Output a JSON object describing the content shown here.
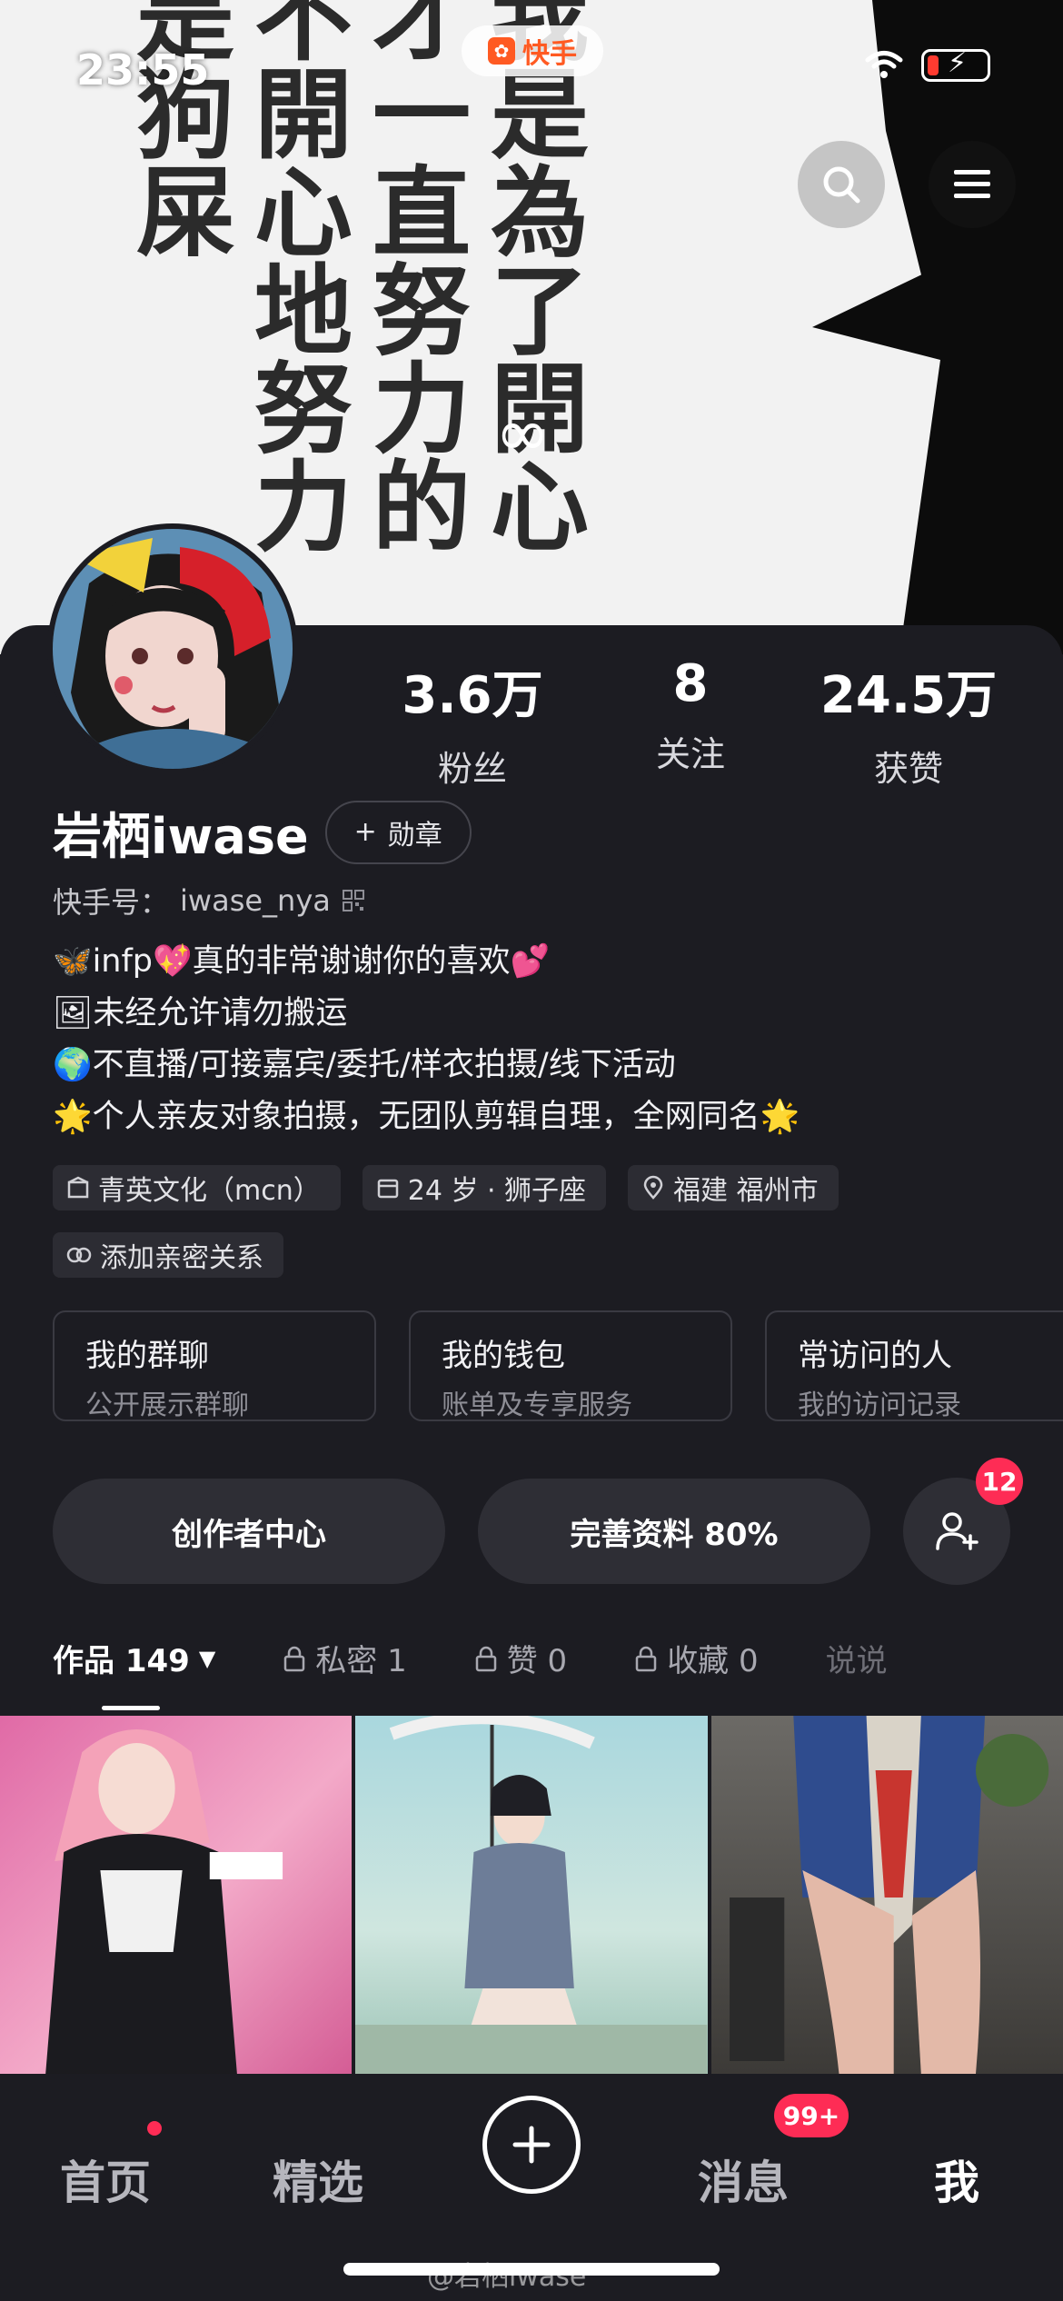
{
  "status_bar": {
    "time": "23:55",
    "app_pill": "快手"
  },
  "banner": {
    "columns": [
      [
        "我",
        "是",
        "為",
        "了",
        "開",
        "心"
      ],
      [
        "才",
        "一",
        "直",
        "努",
        "力",
        "的"
      ],
      [
        "不",
        "開",
        "心",
        "地",
        "努",
        "力"
      ],
      [
        "是",
        "狗",
        "屎"
      ]
    ]
  },
  "profile": {
    "stats": [
      {
        "value": "3.6万",
        "label": "粉丝"
      },
      {
        "value": "8",
        "label": "关注"
      },
      {
        "value": "24.5万",
        "label": "获赞"
      }
    ],
    "name": "岩栖iwase",
    "medal_button": "勋章",
    "kuaishou_id_label": "快手号：",
    "kuaishou_id": "iwase_nya",
    "bio": [
      "🦋infp💖真的非常谢谢你的喜欢💕",
      "🖼未经允许请勿搬运",
      "🌍不直播/可接嘉宾/委托/样衣拍摄/线下活动",
      "🌟个人亲友对象拍摄，无团队剪辑自理，全网同名🌟"
    ],
    "tags": [
      "青英文化（mcn）",
      "24 岁 · 狮子座",
      "福建 福州市"
    ],
    "add_relation": "添加亲密关系"
  },
  "quick_cards": [
    {
      "title": "我的群聊",
      "subtitle": "公开展示群聊"
    },
    {
      "title": "我的钱包",
      "subtitle": "账单及专享服务"
    },
    {
      "title": "常访问的人",
      "subtitle": "我的访问记录"
    }
  ],
  "actions": {
    "creator_center": "创作者中心",
    "complete_profile": "完善资料 80%",
    "friend_badge": "12"
  },
  "tabs": [
    {
      "label": "作品 149"
    },
    {
      "label": "私密 1"
    },
    {
      "label": "赞 0"
    },
    {
      "label": "收藏 0"
    },
    {
      "label": "说说"
    }
  ],
  "bottom_nav": {
    "home": "首页",
    "featured": "精选",
    "messages": "消息",
    "messages_badge": "99+",
    "me": "我"
  },
  "watermark": "@岩栖iwase",
  "colors": {
    "accent_red": "#fe2c55",
    "kuaishou_orange": "#ff5a22",
    "bg": "#1c1c22"
  }
}
